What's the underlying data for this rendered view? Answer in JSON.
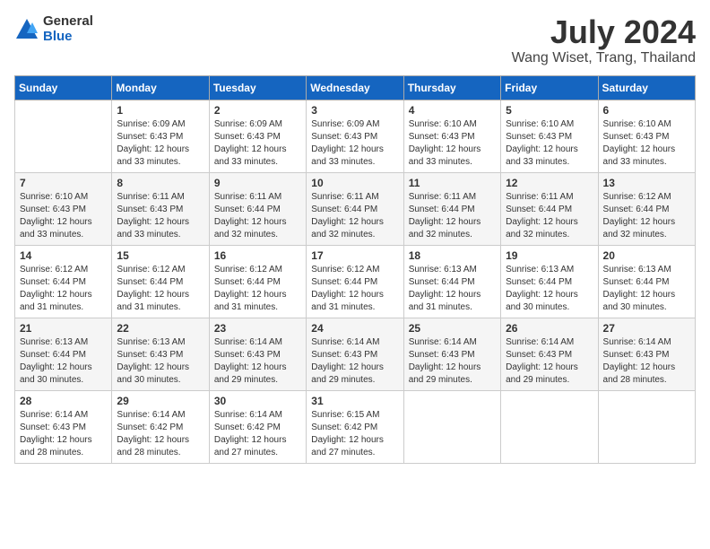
{
  "header": {
    "logo_general": "General",
    "logo_blue": "Blue",
    "month_title": "July 2024",
    "location": "Wang Wiset, Trang, Thailand"
  },
  "weekdays": [
    "Sunday",
    "Monday",
    "Tuesday",
    "Wednesday",
    "Thursday",
    "Friday",
    "Saturday"
  ],
  "weeks": [
    [
      {
        "day": "",
        "info": ""
      },
      {
        "day": "1",
        "info": "Sunrise: 6:09 AM\nSunset: 6:43 PM\nDaylight: 12 hours\nand 33 minutes."
      },
      {
        "day": "2",
        "info": "Sunrise: 6:09 AM\nSunset: 6:43 PM\nDaylight: 12 hours\nand 33 minutes."
      },
      {
        "day": "3",
        "info": "Sunrise: 6:09 AM\nSunset: 6:43 PM\nDaylight: 12 hours\nand 33 minutes."
      },
      {
        "day": "4",
        "info": "Sunrise: 6:10 AM\nSunset: 6:43 PM\nDaylight: 12 hours\nand 33 minutes."
      },
      {
        "day": "5",
        "info": "Sunrise: 6:10 AM\nSunset: 6:43 PM\nDaylight: 12 hours\nand 33 minutes."
      },
      {
        "day": "6",
        "info": "Sunrise: 6:10 AM\nSunset: 6:43 PM\nDaylight: 12 hours\nand 33 minutes."
      }
    ],
    [
      {
        "day": "7",
        "info": "Sunrise: 6:10 AM\nSunset: 6:43 PM\nDaylight: 12 hours\nand 33 minutes."
      },
      {
        "day": "8",
        "info": "Sunrise: 6:11 AM\nSunset: 6:43 PM\nDaylight: 12 hours\nand 33 minutes."
      },
      {
        "day": "9",
        "info": "Sunrise: 6:11 AM\nSunset: 6:44 PM\nDaylight: 12 hours\nand 32 minutes."
      },
      {
        "day": "10",
        "info": "Sunrise: 6:11 AM\nSunset: 6:44 PM\nDaylight: 12 hours\nand 32 minutes."
      },
      {
        "day": "11",
        "info": "Sunrise: 6:11 AM\nSunset: 6:44 PM\nDaylight: 12 hours\nand 32 minutes."
      },
      {
        "day": "12",
        "info": "Sunrise: 6:11 AM\nSunset: 6:44 PM\nDaylight: 12 hours\nand 32 minutes."
      },
      {
        "day": "13",
        "info": "Sunrise: 6:12 AM\nSunset: 6:44 PM\nDaylight: 12 hours\nand 32 minutes."
      }
    ],
    [
      {
        "day": "14",
        "info": "Sunrise: 6:12 AM\nSunset: 6:44 PM\nDaylight: 12 hours\nand 31 minutes."
      },
      {
        "day": "15",
        "info": "Sunrise: 6:12 AM\nSunset: 6:44 PM\nDaylight: 12 hours\nand 31 minutes."
      },
      {
        "day": "16",
        "info": "Sunrise: 6:12 AM\nSunset: 6:44 PM\nDaylight: 12 hours\nand 31 minutes."
      },
      {
        "day": "17",
        "info": "Sunrise: 6:12 AM\nSunset: 6:44 PM\nDaylight: 12 hours\nand 31 minutes."
      },
      {
        "day": "18",
        "info": "Sunrise: 6:13 AM\nSunset: 6:44 PM\nDaylight: 12 hours\nand 31 minutes."
      },
      {
        "day": "19",
        "info": "Sunrise: 6:13 AM\nSunset: 6:44 PM\nDaylight: 12 hours\nand 30 minutes."
      },
      {
        "day": "20",
        "info": "Sunrise: 6:13 AM\nSunset: 6:44 PM\nDaylight: 12 hours\nand 30 minutes."
      }
    ],
    [
      {
        "day": "21",
        "info": "Sunrise: 6:13 AM\nSunset: 6:44 PM\nDaylight: 12 hours\nand 30 minutes."
      },
      {
        "day": "22",
        "info": "Sunrise: 6:13 AM\nSunset: 6:43 PM\nDaylight: 12 hours\nand 30 minutes."
      },
      {
        "day": "23",
        "info": "Sunrise: 6:14 AM\nSunset: 6:43 PM\nDaylight: 12 hours\nand 29 minutes."
      },
      {
        "day": "24",
        "info": "Sunrise: 6:14 AM\nSunset: 6:43 PM\nDaylight: 12 hours\nand 29 minutes."
      },
      {
        "day": "25",
        "info": "Sunrise: 6:14 AM\nSunset: 6:43 PM\nDaylight: 12 hours\nand 29 minutes."
      },
      {
        "day": "26",
        "info": "Sunrise: 6:14 AM\nSunset: 6:43 PM\nDaylight: 12 hours\nand 29 minutes."
      },
      {
        "day": "27",
        "info": "Sunrise: 6:14 AM\nSunset: 6:43 PM\nDaylight: 12 hours\nand 28 minutes."
      }
    ],
    [
      {
        "day": "28",
        "info": "Sunrise: 6:14 AM\nSunset: 6:43 PM\nDaylight: 12 hours\nand 28 minutes."
      },
      {
        "day": "29",
        "info": "Sunrise: 6:14 AM\nSunset: 6:42 PM\nDaylight: 12 hours\nand 28 minutes."
      },
      {
        "day": "30",
        "info": "Sunrise: 6:14 AM\nSunset: 6:42 PM\nDaylight: 12 hours\nand 27 minutes."
      },
      {
        "day": "31",
        "info": "Sunrise: 6:15 AM\nSunset: 6:42 PM\nDaylight: 12 hours\nand 27 minutes."
      },
      {
        "day": "",
        "info": ""
      },
      {
        "day": "",
        "info": ""
      },
      {
        "day": "",
        "info": ""
      }
    ]
  ]
}
